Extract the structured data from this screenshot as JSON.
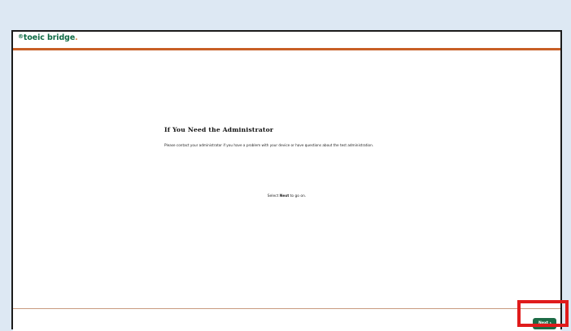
{
  "brand": {
    "logo_mark": "®",
    "logo_text": "toeic bridge",
    "logo_dot": ".",
    "colors": {
      "green": "#0f6b45",
      "orange": "#c85f26"
    }
  },
  "main": {
    "title": "If You Need the Administrator",
    "body": "Please contact your administrator if you have a problem with your device or have questions about the test administration.",
    "instruction_prefix": "Select ",
    "instruction_bold": "Next",
    "instruction_suffix": " to go on."
  },
  "footer": {
    "next_label": "Next",
    "next_icon": "chevron-right-icon",
    "next_glyph": "›"
  },
  "annotation": {
    "highlight_color": "#e01b1b"
  }
}
